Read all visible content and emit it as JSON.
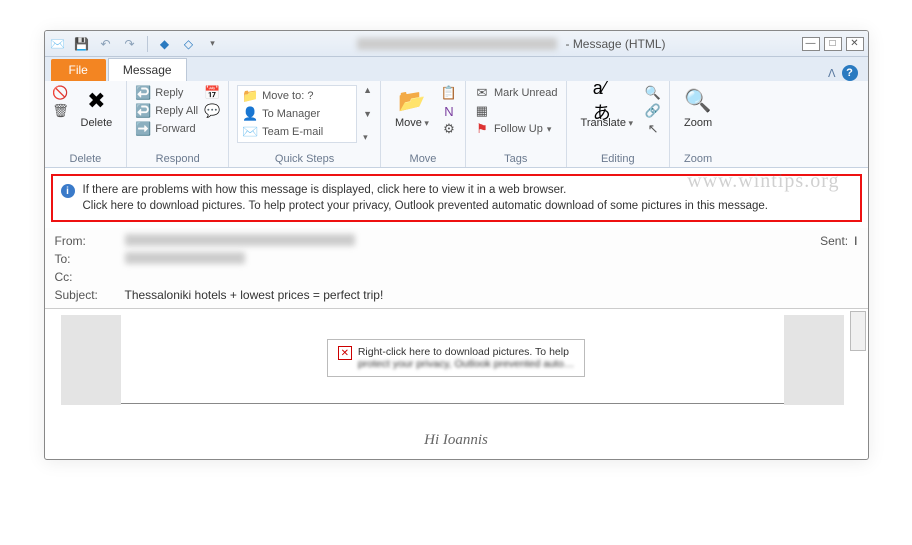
{
  "titlebar": {
    "title_suffix": "- Message (HTML)"
  },
  "tabs": {
    "file": "File",
    "message": "Message"
  },
  "ribbon": {
    "delete": {
      "label": "Delete",
      "group": "Delete"
    },
    "respond": {
      "reply": "Reply",
      "reply_all": "Reply All",
      "forward": "Forward",
      "group": "Respond"
    },
    "quicksteps": {
      "move_to": "Move to: ?",
      "to_manager": "To Manager",
      "team_email": "Team E-mail",
      "group": "Quick Steps"
    },
    "move": {
      "label": "Move",
      "group": "Move"
    },
    "tags": {
      "mark_unread": "Mark Unread",
      "follow_up": "Follow Up",
      "group": "Tags"
    },
    "editing": {
      "translate": "Translate",
      "group": "Editing"
    },
    "zoom": {
      "label": "Zoom",
      "group": "Zoom"
    }
  },
  "infobar": {
    "line1": "If there are problems with how this message is displayed, click here to view it in a web browser.",
    "line2": "Click here to download pictures. To help protect your privacy, Outlook prevented automatic download of some pictures in this message."
  },
  "headers": {
    "from_label": "From:",
    "to_label": "To:",
    "cc_label": "Cc:",
    "subject_label": "Subject:",
    "subject_value": "Thessaloniki hotels + lowest prices = perfect trip!",
    "sent_label": "Sent:",
    "sent_value": "I"
  },
  "body": {
    "img_placeholder": "Right-click here to download pictures.  To help",
    "img_placeholder2": "protect your privacy, Outlook prevented auto…",
    "greeting": "Hi Ioannis"
  },
  "watermark": "www.wintips.org"
}
